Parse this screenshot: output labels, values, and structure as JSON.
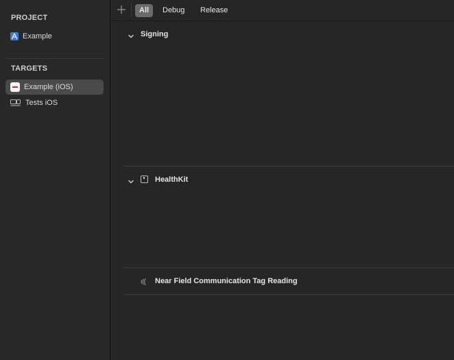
{
  "sidebar": {
    "project_header": "PROJECT",
    "project_items": [
      {
        "label": "Example",
        "icon": "project-blueprint-icon"
      }
    ],
    "targets_header": "TARGETS",
    "target_items": [
      {
        "label": "Example (iOS)",
        "icon": "app-target-icon",
        "selected": true
      },
      {
        "label": "Tests iOS",
        "icon": "test-bundle-icon",
        "selected": false
      }
    ]
  },
  "toolbar": {
    "add_icon": "plus-icon",
    "filters": [
      {
        "label": "All",
        "active": true
      },
      {
        "label": "Debug",
        "active": false
      },
      {
        "label": "Release",
        "active": false
      }
    ]
  },
  "capabilities": [
    {
      "title": "Signing",
      "expanded": true,
      "icon": ""
    },
    {
      "title": "HealthKit",
      "expanded": true,
      "icon": "healthkit-icon"
    },
    {
      "title": "Near Field Communication Tag Reading",
      "expanded": false,
      "icon": "nfc-icon"
    }
  ],
  "colors": {
    "background": "#262626",
    "sidebar_selected": "#4a4a4a",
    "segment_active": "#6b6b6b",
    "project_icon": "#3d7bd9"
  }
}
